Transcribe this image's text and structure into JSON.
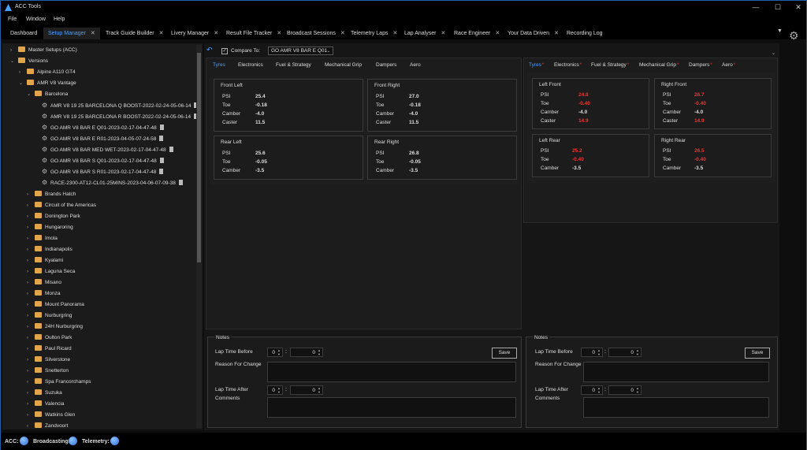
{
  "window": {
    "title": "ACC Tools",
    "minimize": "—",
    "maximize": "☐",
    "close": "✕"
  },
  "menu": [
    "File",
    "Window",
    "Help"
  ],
  "tabs": [
    {
      "label": "Dashboard"
    },
    {
      "label": "Setup Manager",
      "active": true
    },
    {
      "label": "Track Guide Builder"
    },
    {
      "label": "Livery Manager"
    },
    {
      "label": "Result File Tracker"
    },
    {
      "label": "Broadcast Sessions"
    },
    {
      "label": "Telemetry Laps"
    },
    {
      "label": "Lap Analyser"
    },
    {
      "label": "Race Engineer"
    },
    {
      "label": "Your Data Driven"
    },
    {
      "label": "Recording Log"
    }
  ],
  "tree": {
    "master": "Master Setups (ACC)",
    "versions": "Versions",
    "alpine": "Alpine A110 GT4",
    "amr": "AMR V8 Vantage",
    "barcelona": "Barcelona",
    "setups": [
      "AMR V8 19 25 BARCELONA Q BOOST-2022-02-24-05-06-14",
      "AMR V8 19 25 BARCELONA R BOOST-2022-02-24-05-06-14",
      "GO AMR V8 BAR E Q01-2023-02-17-04-47-48",
      "GO AMR V8 BAR E R01-2023-04-05-07-24-58",
      "GO AMR V8 BAR MED WET-2023-02-17-04-47-48",
      "GO AMR V8 BAR S Q01-2023-02-17-04-47-48",
      "GO AMR V8 BAR S R01-2023-02-17-04-47-48",
      "RACE-2300-AT12-CL01-25MINS-2023-04-06-07-09-38"
    ],
    "tracks": [
      "Brands Hatch",
      "Circuit of the Americas",
      "Donington Park",
      "Hungaroring",
      "Imola",
      "Indianapolis",
      "Kyalami",
      "Laguna Seca",
      "Misano",
      "Monza",
      "Mount Panorama",
      "Nurburgring",
      "24H Nurburgring",
      "Oulton Park",
      "Paul Ricard",
      "Silverstone",
      "Snetterton",
      "Spa Francorchamps",
      "Suzuka",
      "Valencia",
      "Watkins Glen",
      "Zandvoort"
    ]
  },
  "compare": {
    "label": "Compare To:",
    "value": "GO AMR V8 BAR E Q01",
    "checked": true
  },
  "left": {
    "subtabs": [
      "Tyres",
      "Electronics",
      "Fuel & Strategy",
      "Mechanical Grip",
      "Dampers",
      "Aero"
    ],
    "fl": {
      "title": "Front Left",
      "psi": "25.4",
      "toe": "-0.18",
      "camber": "-4.0",
      "caster": "11.5"
    },
    "fr": {
      "title": "Front Right",
      "psi": "27.0",
      "toe": "-0.18",
      "camber": "-4.0",
      "caster": "11.5"
    },
    "rl": {
      "title": "Rear Left",
      "psi": "25.6",
      "toe": "-0.05",
      "camber": "-3.5"
    },
    "rr": {
      "title": "Rear Right",
      "psi": "26.8",
      "toe": "-0.05",
      "camber": "-3.5"
    }
  },
  "right": {
    "subtabs": [
      "Tyres",
      "Electronics",
      "Fuel & Strategy",
      "Mechanical Grip",
      "Dampers",
      "Aero"
    ],
    "lf": {
      "title": "Left Front",
      "psi": "24.8",
      "toe": "-0.40",
      "camber": "-4.0",
      "caster": "14.9"
    },
    "rf": {
      "title": "Right Front",
      "psi": "26.7",
      "toe": "-0.40",
      "camber": "-4.0",
      "caster": "14.9"
    },
    "lr": {
      "title": "Left Rear",
      "psi": "25.2",
      "toe": "-0.40",
      "camber": "-3.5"
    },
    "rrr": {
      "title": "Right Rear",
      "psi": "26.5",
      "toe": "-0.40",
      "camber": "-3.5"
    }
  },
  "labels": {
    "psi": "PSI",
    "toe": "Toe",
    "camber": "Camber",
    "caster": "Caster"
  },
  "notes": {
    "title": "Notes",
    "lap_before": "Lap Time Before",
    "reason": "Reason For Change",
    "lap_after": "Lap Time After",
    "comments": "Comments",
    "save": "Save",
    "zero": "0",
    "colon": ":"
  },
  "status": {
    "acc": "ACC:",
    "broadcasting": "Broadcasting:",
    "telemetry": "Telemetry:"
  },
  "colors": {
    "accent": "#4aa0ff",
    "diff": "#e33333",
    "folder": "#e0a44a"
  }
}
